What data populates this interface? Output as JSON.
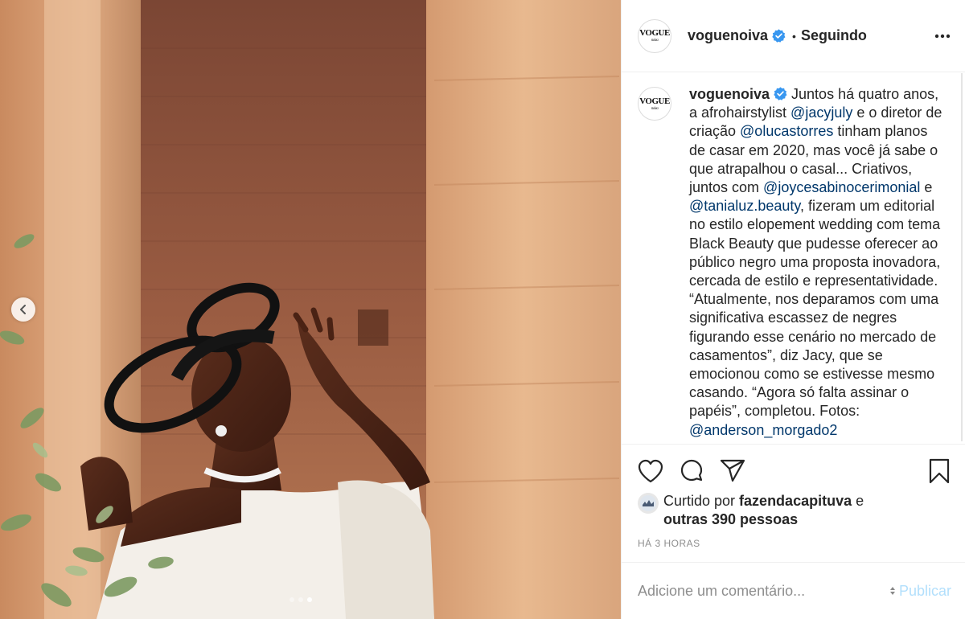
{
  "post": {
    "username": "voguenoiva",
    "follow_status": "Seguindo",
    "avatar_logo": "VOGUE",
    "avatar_logo_sub": "noiva"
  },
  "caption": {
    "username": "voguenoiva",
    "seg1": " Juntos há quatro anos, a afrohairstylist ",
    "m1": "@jacyjuly",
    "seg2": " e o diretor de criação ",
    "m2": "@olucastorres",
    "seg3": " tinham planos de casar em 2020, mas você já sabe o que atrapalhou o casal... Criativos, juntos com ",
    "m3": "@joycesabinocerimonial",
    "seg4": " e ",
    "m4": "@tanialuz.beauty",
    "seg5": ", fizeram um editorial no estilo elopement wedding com tema Black Beauty que pudesse oferecer ao público negro uma proposta inovadora, cercada de estilo e representatividade. “Atualmente, nos deparamos com uma significativa escassez de negres figurando esse cenário no mercado de casamentos”, diz Jacy, que se emocionou como se estivesse mesmo casando. “Agora só falta assinar o papéis”, completou. Fotos: ",
    "m5": "@anderson_morgado2"
  },
  "likes": {
    "prefix": "Curtido por ",
    "user": "fazendacapituva",
    "middle": " e",
    "others": "outras 390 pessoas"
  },
  "time_ago": "HÁ 3 HORAS",
  "comment": {
    "placeholder": "Adicione um comentário...",
    "publish_label": "Publicar"
  },
  "carousel": {
    "slide_count": 3,
    "active_index": 2
  },
  "colors": {
    "verified": "#3897f0",
    "mention": "#00376b",
    "publish_disabled": "#b2dffc",
    "muted": "#8e8e8e"
  },
  "icons": {
    "more": "more-horizontal-icon",
    "like": "heart-icon",
    "comment": "comment-icon",
    "share": "paper-plane-icon",
    "save": "bookmark-icon",
    "prev": "chevron-left-icon"
  }
}
